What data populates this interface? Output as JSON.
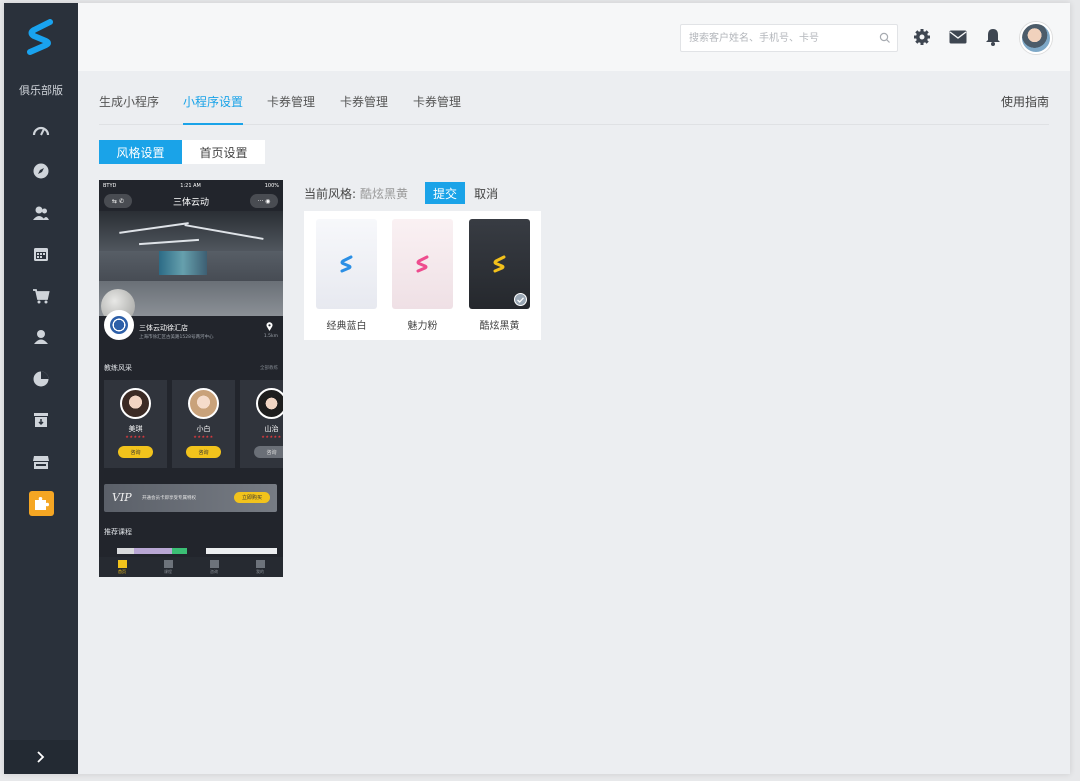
{
  "sidebar": {
    "club_label": "俱乐部版",
    "icons": [
      "dashboard-icon",
      "compass-icon",
      "members-icon",
      "calendar-icon",
      "cart-icon",
      "user-icon",
      "pie-chart-icon",
      "archive-icon",
      "store-icon",
      "plugin-icon"
    ],
    "active_icon": "plugin-icon",
    "expand_icon": "chevron-right-icon"
  },
  "topbar": {
    "search_placeholder": "搜索客户姓名、手机号、卡号",
    "icons": [
      "gear-icon",
      "mail-icon",
      "bell-icon"
    ]
  },
  "tabs": [
    {
      "label": "生成小程序",
      "active": false
    },
    {
      "label": "小程序设置",
      "active": true
    },
    {
      "label": "卡券管理",
      "active": false
    },
    {
      "label": "卡券管理",
      "active": false
    },
    {
      "label": "卡券管理",
      "active": false
    }
  ],
  "guide_link": "使用指南",
  "segments": [
    {
      "label": "风格设置",
      "active": true
    },
    {
      "label": "首页设置",
      "active": false
    }
  ],
  "preview": {
    "status": {
      "carrier": "BTYD",
      "time": "1:21 AM",
      "battery": "100%"
    },
    "nav_title": "三体云动",
    "store": {
      "name": "三体云动徐汇店",
      "address": "上海市徐汇区古美路1528号两河中心",
      "distance": "1.5km"
    },
    "coach_section": {
      "title": "教练风采",
      "more": "全部教练"
    },
    "coaches": [
      {
        "name": "美琪",
        "button": "咨询"
      },
      {
        "name": "小白",
        "button": "咨询"
      },
      {
        "name": "山治",
        "button": "咨询"
      }
    ],
    "vip": {
      "mark": "VIP",
      "text": "开通会员卡即享受专属特权",
      "button": "立即购买"
    },
    "courses_title": "推荐课程",
    "tabbar": [
      "首页",
      "课程",
      "咨询",
      "我的"
    ]
  },
  "style": {
    "current_label": "当前风格:",
    "current_value": "酷炫黑黄",
    "submit_label": "提交",
    "cancel_label": "取消",
    "options": [
      {
        "label": "经典蓝白",
        "accent": "#2b8fe5",
        "background": "#eef0f5",
        "selected": false
      },
      {
        "label": "魅力粉",
        "accent": "#ee4c8e",
        "background": "#f6eaee",
        "selected": false
      },
      {
        "label": "酷炫黑黄",
        "accent": "#f3c11b",
        "background": "#2a2d33",
        "selected": true
      }
    ]
  },
  "colors": {
    "accent": "#1aa3e8",
    "sidebar": "#2a313b",
    "plugin_active": "#f5a623"
  }
}
